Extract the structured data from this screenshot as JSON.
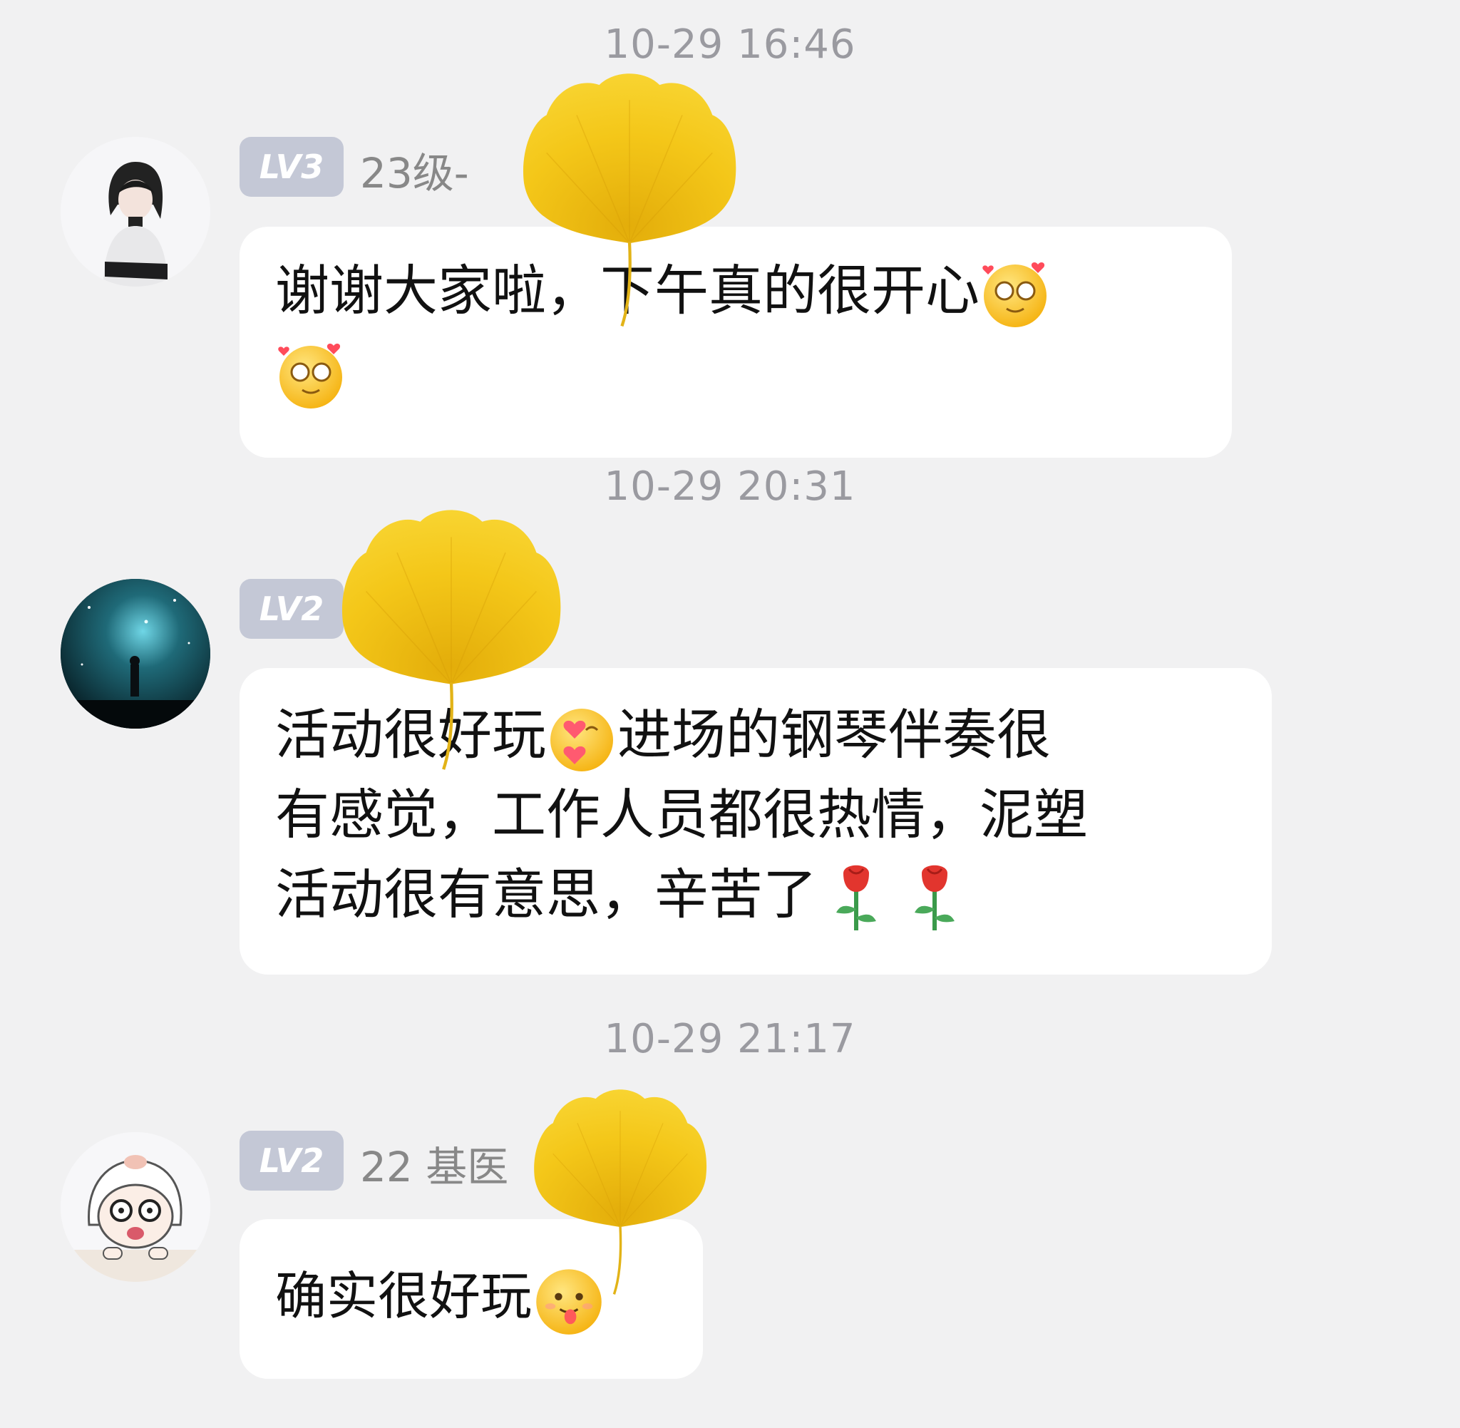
{
  "messages": [
    {
      "timestamp": "10-29 16:46",
      "level": "LV3",
      "nickname": "23级-",
      "text_line1": "谢谢大家啦，下午真的很开心",
      "text_line2": "",
      "text_line3": "",
      "emoji": "heart-eyes-emoji"
    },
    {
      "timestamp": "10-29 20:31",
      "level": "LV2",
      "nickname": "",
      "text_line1_a": "活动很好玩",
      "text_line1_b": "进场的钢琴伴奏很",
      "text_line2": "有感觉，工作人员都很热情，泥塑",
      "text_line3": "活动很有意思，辛苦了",
      "emoji": "kiss-emoji"
    },
    {
      "timestamp": "10-29 21:17",
      "level": "LV2",
      "nickname": "22 基医",
      "text_line1": "确实很好玩",
      "emoji": "tongue-emoji"
    }
  ],
  "colors": {
    "background": "#f1f1f2",
    "bubble": "#ffffff",
    "level_badge": "#c4c8d6",
    "leaf": "#f2c313"
  }
}
